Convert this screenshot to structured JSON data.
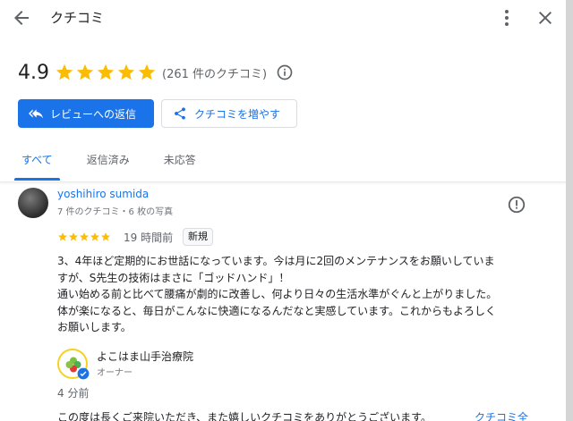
{
  "header": {
    "title": "クチコミ"
  },
  "summary": {
    "rating": "4.9",
    "stars": 5,
    "count_text": "(261 件のクチコミ)",
    "star_color": "#fbbc04"
  },
  "actions": {
    "reply_label": "レビューへの返信",
    "more_reviews_label": "クチコミを増やす"
  },
  "tabs": [
    {
      "label": "すべて",
      "active": true
    },
    {
      "label": "返信済み",
      "active": false
    },
    {
      "label": "未応答",
      "active": false
    }
  ],
  "review": {
    "author": "yoshihiro sumida",
    "meta": "7 件のクチコミ・6 枚の写真",
    "stars": 5,
    "time": "19 時間前",
    "badge": "新規",
    "text": "3、4年ほど定期的にお世話になっています。今は月に2回のメンテナンスをお願いしていま\nすが、S先生の技術はまさに「ゴッドハンド」！\n通い始める前と比べて腰痛が劇的に改善し、何より日々の生活水準がぐんと上がりました。\n体が楽になると、毎日がこんなに快適になるんだなと実感しています。これからもよろしく\nお願いします。"
  },
  "owner_reply": {
    "name": "よこはま山手治療院",
    "role": "オーナー",
    "time": "4 分前",
    "text": "この度は長くご来院いただき、また嬉しいクチコミをありがとうございます。",
    "more_label": "クチコミ全"
  },
  "colors": {
    "accent": "#1a73e8",
    "text": "#202124",
    "secondary": "#5f6368"
  }
}
